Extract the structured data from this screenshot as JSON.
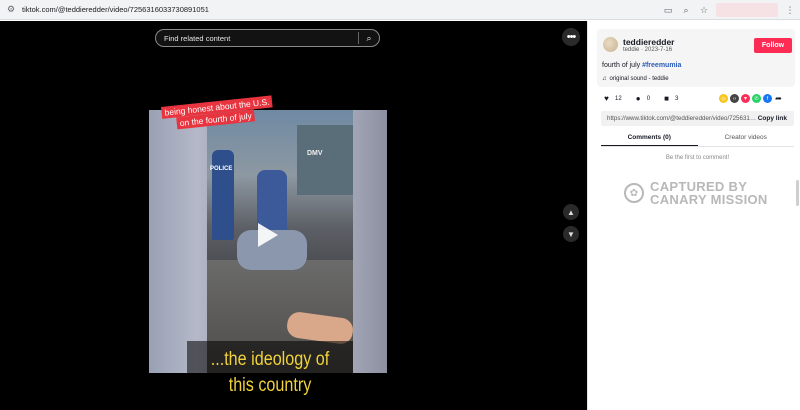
{
  "browser": {
    "url": "tiktok.com/@teddieredder/video/7256316033730891051",
    "icons": [
      "site-settings-icon",
      "cast-icon",
      "zoom-icon",
      "bookmark-star-icon",
      "kebab-menu-icon"
    ]
  },
  "video": {
    "search_placeholder": "Find related content",
    "caption_line1": "being honest about the U.S.",
    "caption_line2": "on the fourth of july",
    "subtitle": "...the ideology of this country",
    "scene_sign": "DMV",
    "scene_police": "POLICE"
  },
  "post": {
    "username": "teddieredder",
    "meta": "teddie · 2023-7-16",
    "follow_label": "Follow",
    "description": "fourth of july ",
    "hashtag": "#freemumia",
    "sound": "original sound - teddie",
    "likes": "12",
    "comments": "0",
    "saves": "3",
    "link": "https://www.tiktok.com/@teddieredder/video/7256316...",
    "copy_label": "Copy link"
  },
  "tabs": {
    "comments": "Comments (0)",
    "creator": "Creator videos"
  },
  "comments_empty": "Be the first to comment!",
  "watermark": {
    "line1": "CAPTURED BY",
    "line2": "CANARY MISSION"
  },
  "colors": {
    "accent": "#fe2c55",
    "hashtag": "#2b5db9",
    "subtitle": "#f0d23a",
    "caption_bg": "#e8343f"
  }
}
